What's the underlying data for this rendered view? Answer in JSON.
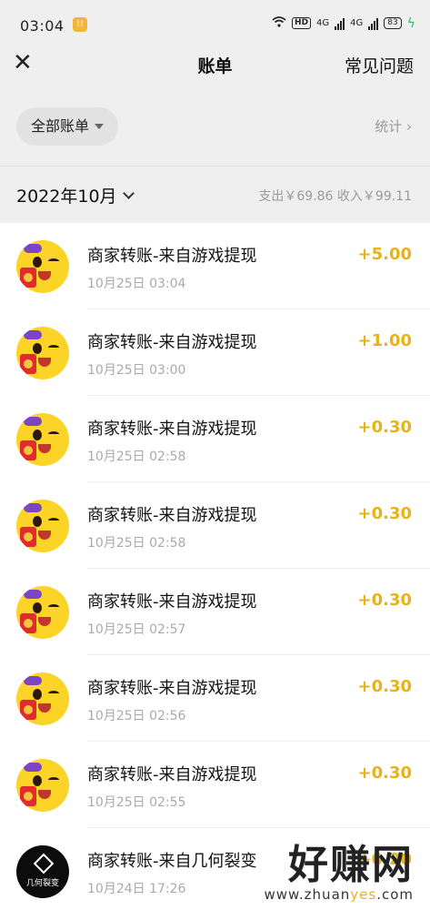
{
  "status": {
    "time": "03:04",
    "notif_badge": "!!",
    "hd": "HD",
    "net1": "4G",
    "net2": "4G",
    "battery": "83"
  },
  "nav": {
    "title": "账单",
    "faq": "常见问题"
  },
  "filter": {
    "label": "全部账单",
    "stats": "统计 ›"
  },
  "month": {
    "label": "2022年10月",
    "summary": "支出￥69.86  收入￥99.11"
  },
  "items": [
    {
      "name": "商家转账-来自游戏提现",
      "time": "10月25日 03:04",
      "amount": "+5.00"
    },
    {
      "name": "商家转账-来自游戏提现",
      "time": "10月25日 03:00",
      "amount": "+1.00"
    },
    {
      "name": "商家转账-来自游戏提现",
      "time": "10月25日 02:58",
      "amount": "+0.30"
    },
    {
      "name": "商家转账-来自游戏提现",
      "time": "10月25日 02:58",
      "amount": "+0.30"
    },
    {
      "name": "商家转账-来自游戏提现",
      "time": "10月25日 02:57",
      "amount": "+0.30"
    },
    {
      "name": "商家转账-来自游戏提现",
      "time": "10月25日 02:56",
      "amount": "+0.30"
    },
    {
      "name": "商家转账-来自游戏提现",
      "time": "10月25日 02:55",
      "amount": "+0.30"
    },
    {
      "name": "商家转账-来自几何裂变",
      "time": "10月24日 17:26",
      "amount": "+0.20",
      "avatar_text": "几何裂变"
    }
  ],
  "watermark": {
    "big": "好赚网",
    "small_a": "www.zhuan",
    "small_b": "yes",
    "small_c": ".com"
  },
  "colors": {
    "amount": "#e8b219",
    "background_top": "#efefef"
  }
}
